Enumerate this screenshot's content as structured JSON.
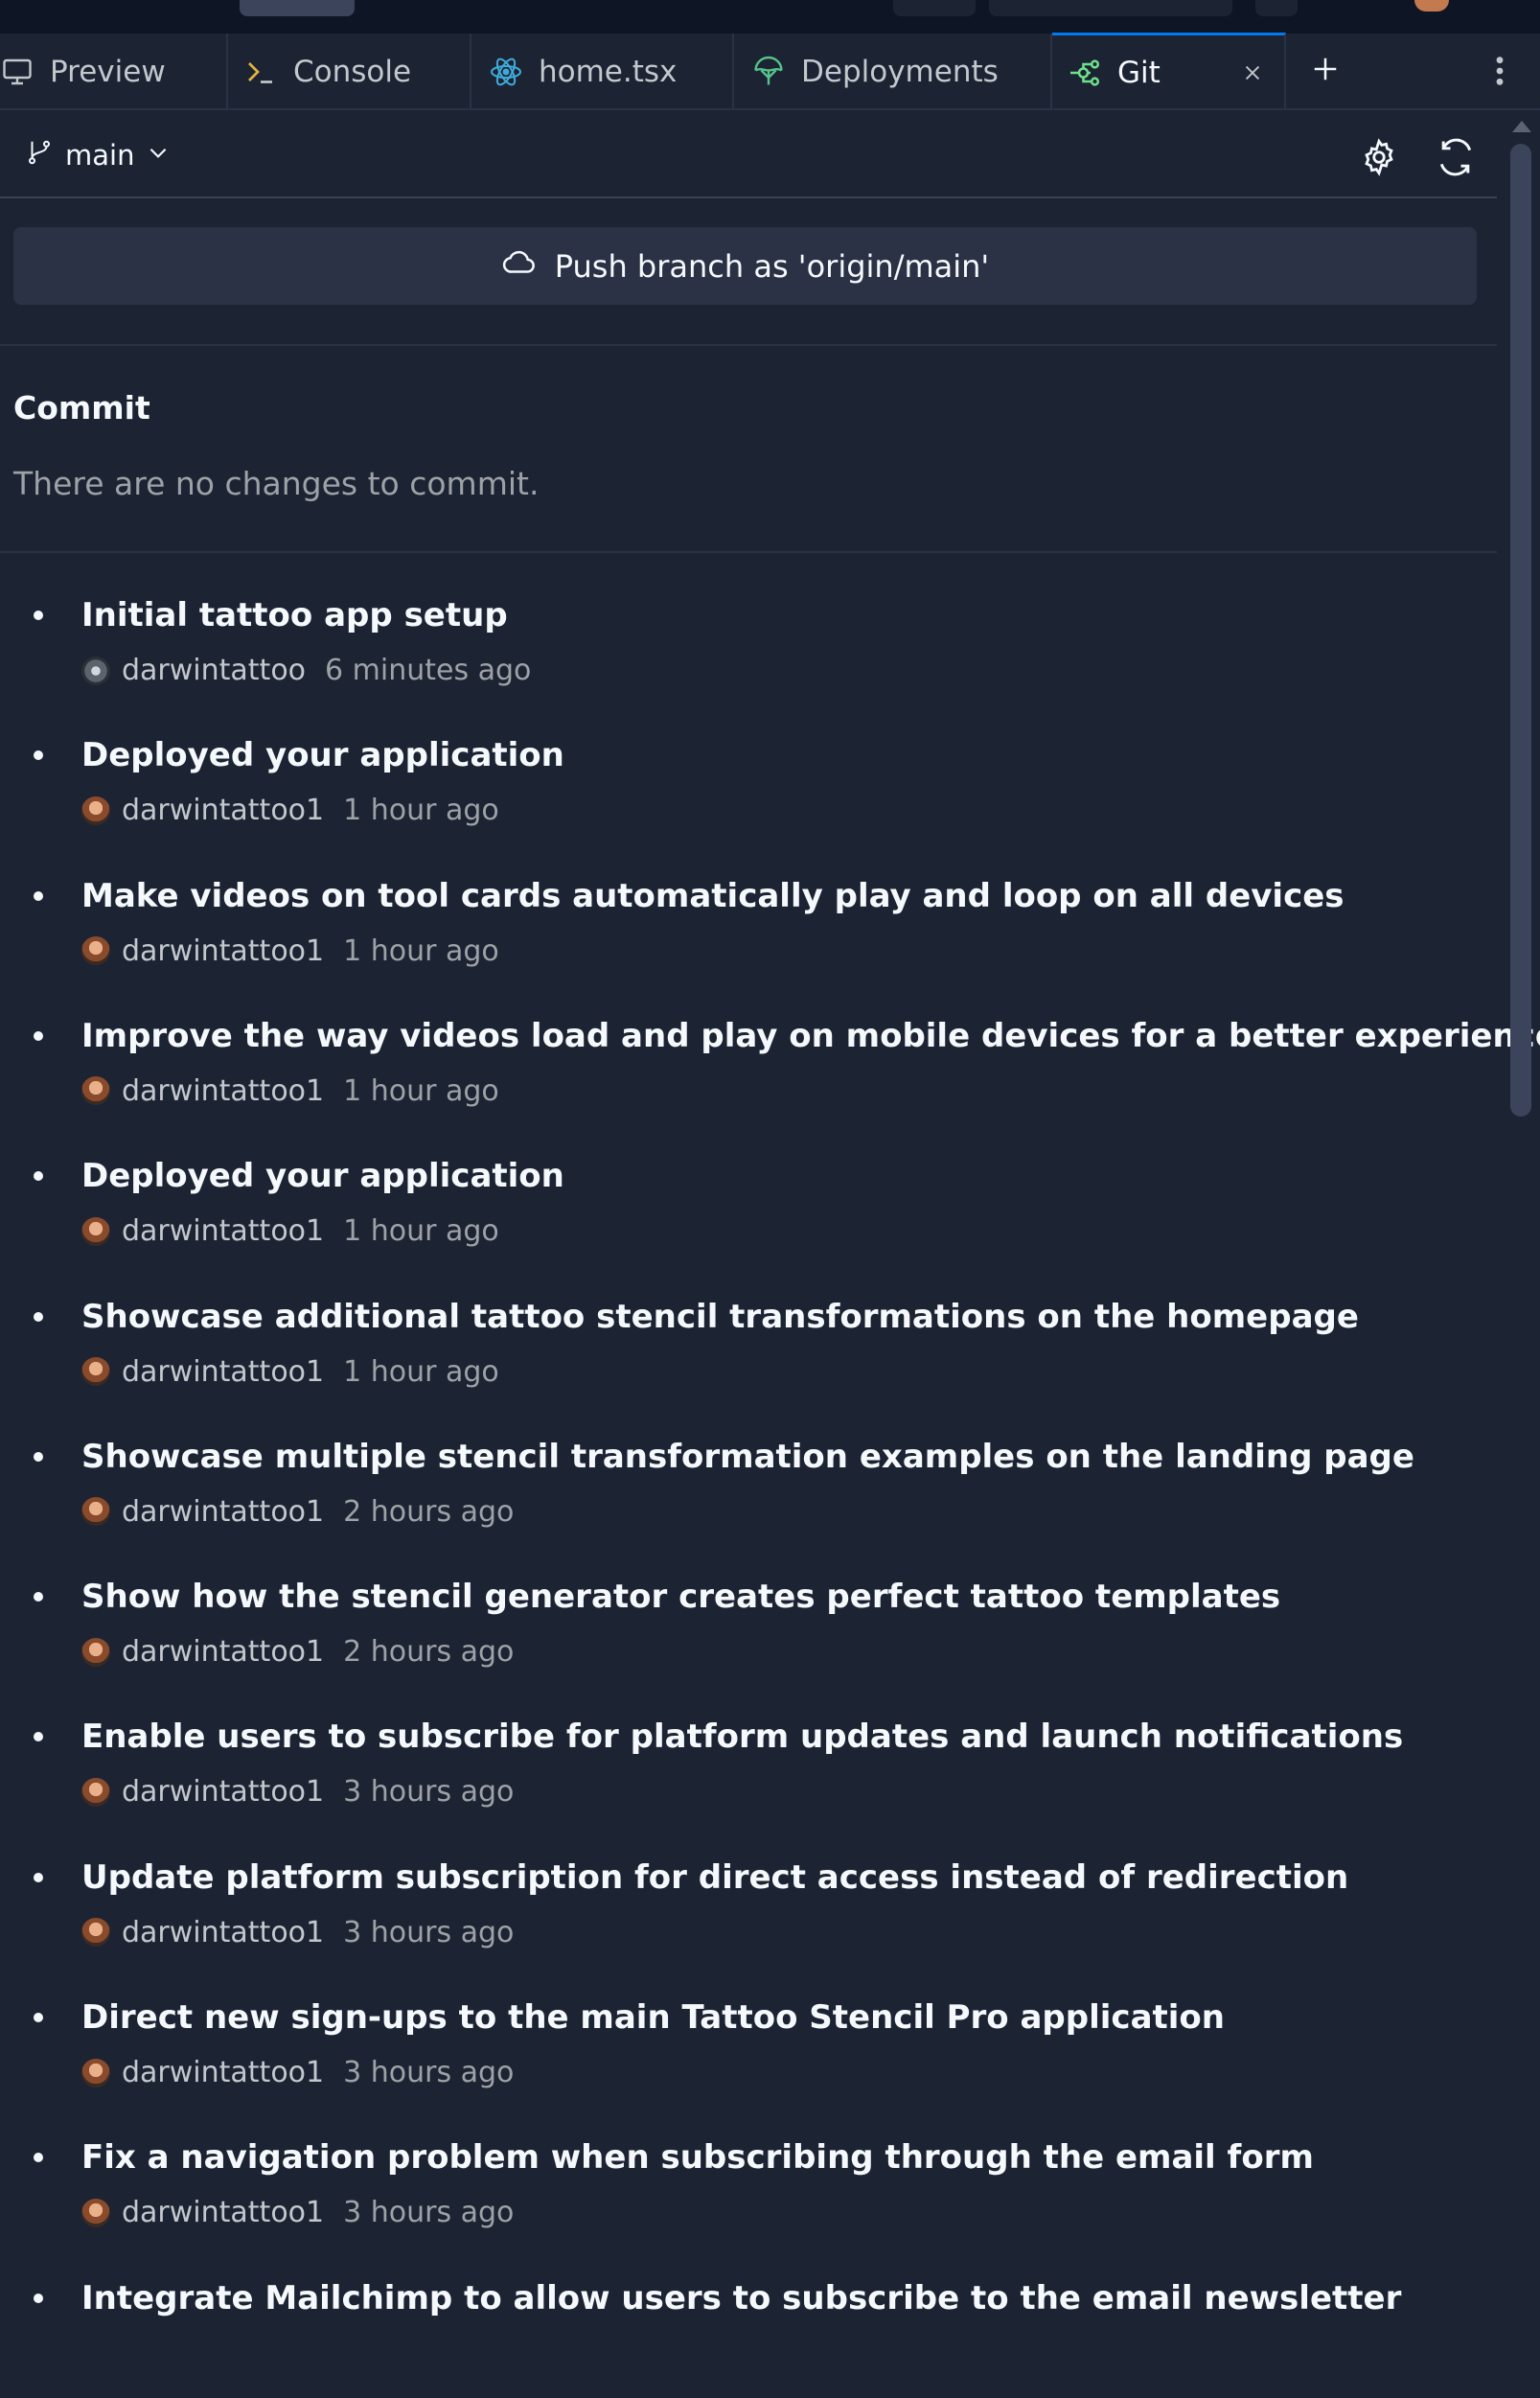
{
  "colors": {
    "background": "#1c2333",
    "surface": "#2b3245",
    "text": "#f5f9fc",
    "muted": "#9da2a6",
    "active_tab_accent": "#0079f2",
    "react_icon": "#3fa9d8",
    "deploy_icon": "#57c28a",
    "git_icon": "#6ee08a"
  },
  "tabs": [
    {
      "label": "Preview",
      "icon": "monitor-icon"
    },
    {
      "label": "Console",
      "icon": "terminal-prompt-icon"
    },
    {
      "label": "home.tsx",
      "icon": "react-icon"
    },
    {
      "label": "Deployments",
      "icon": "deploy-icon"
    },
    {
      "label": "Git",
      "icon": "git-icon",
      "active": true
    }
  ],
  "git": {
    "branch": "main",
    "push_label": "Push branch as 'origin/main'",
    "commit_heading": "Commit",
    "no_changes": "There are no changes to commit."
  },
  "commits": [
    {
      "message": "Initial tattoo app setup",
      "author": "darwintattoo",
      "time": "6 minutes ago"
    },
    {
      "message": "Deployed your application",
      "author": "darwintattoo1",
      "time": "1 hour ago"
    },
    {
      "message": "Make videos on tool cards automatically play and loop on all devices",
      "author": "darwintattoo1",
      "time": "1 hour ago"
    },
    {
      "message": "Improve the way videos load and play on mobile devices for a better experience",
      "author": "darwintattoo1",
      "time": "1 hour ago"
    },
    {
      "message": "Deployed your application",
      "author": "darwintattoo1",
      "time": "1 hour ago"
    },
    {
      "message": "Showcase additional tattoo stencil transformations on the homepage",
      "author": "darwintattoo1",
      "time": "1 hour ago"
    },
    {
      "message": "Showcase multiple stencil transformation examples on the landing page",
      "author": "darwintattoo1",
      "time": "2 hours ago"
    },
    {
      "message": "Show how the stencil generator creates perfect tattoo templates",
      "author": "darwintattoo1",
      "time": "2 hours ago"
    },
    {
      "message": "Enable users to subscribe for platform updates and launch notifications",
      "author": "darwintattoo1",
      "time": "3 hours ago"
    },
    {
      "message": "Update platform subscription for direct access instead of redirection",
      "author": "darwintattoo1",
      "time": "3 hours ago"
    },
    {
      "message": "Direct new sign-ups to the main Tattoo Stencil Pro application",
      "author": "darwintattoo1",
      "time": "3 hours ago"
    },
    {
      "message": "Fix a navigation problem when subscribing through the email form",
      "author": "darwintattoo1",
      "time": "3 hours ago"
    },
    {
      "message": "Integrate Mailchimp to allow users to subscribe to the email newsletter",
      "author": "",
      "time": ""
    }
  ]
}
